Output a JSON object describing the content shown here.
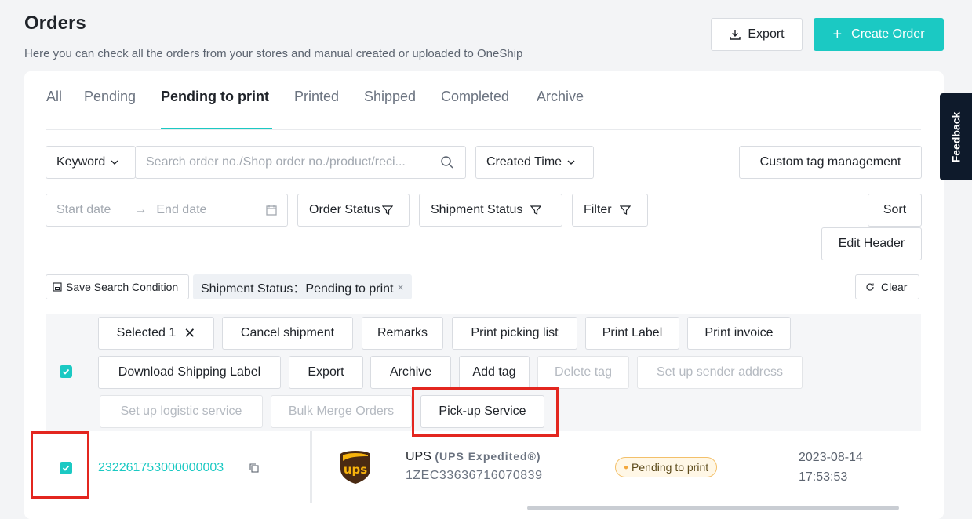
{
  "header": {
    "title": "Orders",
    "subtitle": "Here you can check all the orders from your stores and manual created or uploaded to OneShip",
    "export_label": "Export",
    "create_label": "Create Order"
  },
  "tabs": [
    {
      "label": "All",
      "active": false
    },
    {
      "label": "Pending",
      "active": false
    },
    {
      "label": "Pending to print",
      "active": true
    },
    {
      "label": "Printed",
      "active": false
    },
    {
      "label": "Shipped",
      "active": false
    },
    {
      "label": "Completed",
      "active": false
    },
    {
      "label": "Archive",
      "active": false
    }
  ],
  "search": {
    "keyword_label": "Keyword",
    "placeholder": "Search order no./Shop order no./product/reci...",
    "created_time_label": "Created Time",
    "custom_tag_label": "Custom tag management"
  },
  "filters": {
    "start_date_placeholder": "Start date",
    "end_date_placeholder": "End date",
    "order_status_label": "Order Status",
    "shipment_status_label": "Shipment Status",
    "filter_label": "Filter",
    "sort_label": "Sort",
    "edit_header_label": "Edit Header"
  },
  "conditions": {
    "save_label": "Save Search Condition",
    "chip_label": "Shipment Status：Pending to print",
    "clear_label": "Clear"
  },
  "bulk_actions": {
    "selected_label": "Selected 1",
    "cancel_shipment": "Cancel shipment",
    "remarks": "Remarks",
    "print_picking_list": "Print picking list",
    "print_label": "Print Label",
    "print_invoice": "Print invoice",
    "download_shipping_label": "Download Shipping Label",
    "export": "Export",
    "archive": "Archive",
    "add_tag": "Add tag",
    "delete_tag": "Delete tag",
    "set_sender_address": "Set up sender address",
    "set_logistic_service": "Set up logistic service",
    "bulk_merge_orders": "Bulk Merge Orders",
    "pickup_service": "Pick-up Service"
  },
  "order_row": {
    "order_no": "232261753000000003",
    "carrier_logo": "ups",
    "carrier_name": "UPS",
    "service": "(UPS Expedited®)",
    "tracking": "1ZEC33636716070839",
    "status": "Pending to print",
    "date": "2023-08-14",
    "time": "17:53:53"
  },
  "feedback_label": "Feedback",
  "colors": {
    "accent": "#1bc9c3",
    "highlight": "#e3261f",
    "pending": "#f3a73b"
  }
}
